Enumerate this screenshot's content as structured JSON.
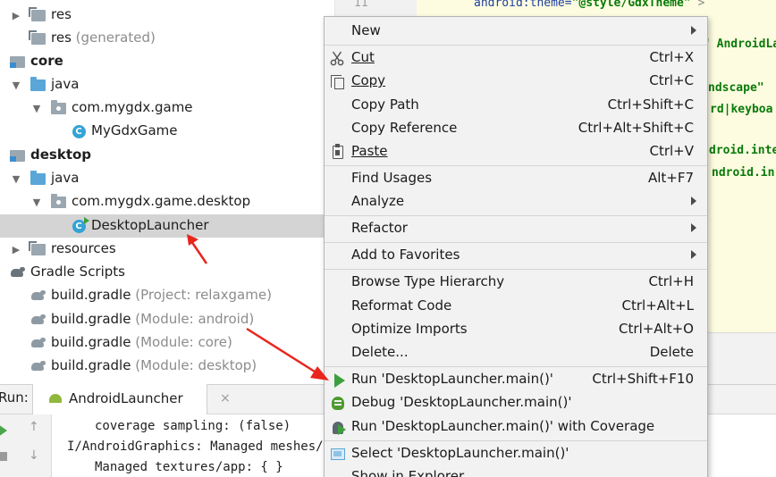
{
  "tree": {
    "rows": [
      {
        "label": "res",
        "extra": ""
      },
      {
        "label": "res",
        "extra": "(generated)"
      },
      {
        "label": "core",
        "extra": ""
      },
      {
        "label": "java",
        "extra": ""
      },
      {
        "label": "com.mygdx.game",
        "extra": ""
      },
      {
        "label": "MyGdxGame",
        "extra": ""
      },
      {
        "label": "desktop",
        "extra": ""
      },
      {
        "label": "java",
        "extra": ""
      },
      {
        "label": "com.mygdx.game.desktop",
        "extra": ""
      },
      {
        "label": "DesktopLauncher",
        "extra": ""
      },
      {
        "label": "resources",
        "extra": ""
      },
      {
        "label": "Gradle Scripts",
        "extra": ""
      },
      {
        "label": "build.gradle",
        "extra": "(Project: relaxgame)"
      },
      {
        "label": "build.gradle",
        "extra": "(Module: android)"
      },
      {
        "label": "build.gradle",
        "extra": "(Module: core)"
      },
      {
        "label": "build.gradle",
        "extra": "(Module: desktop)"
      }
    ]
  },
  "editor": {
    "line_number": "11",
    "lines": [
      {
        "attr": "android:theme=",
        "str": "\"@style/GdxTheme\"",
        "tail": " >"
      },
      {
        "attr": "",
        "str": "\" AndroidLa",
        "tail": ""
      },
      {
        "attr": "",
        "str": "ndscape\"",
        "tail": ""
      },
      {
        "attr": "",
        "str": "rd|keyboa",
        "tail": ""
      },
      {
        "attr": "",
        "str": "droid.inte",
        "tail": ""
      },
      {
        "attr": "",
        "str": "ndroid.in",
        "tail": ""
      }
    ]
  },
  "run_panel": {
    "title": "Run:",
    "tab_label": "AndroidLauncher",
    "tab_close": "×",
    "console_lines": [
      "    coverage sampling: (false)",
      "I/AndroidGraphics: Managed meshes/ap",
      "    Managed textures/app: { }"
    ]
  },
  "menu": {
    "items": [
      {
        "key": "new",
        "label": "New",
        "shortcut": "",
        "submenu": true
      },
      {
        "key": "cut",
        "label": "Cut",
        "shortcut": "Ctrl+X",
        "submenu": false
      },
      {
        "key": "copy",
        "label": "Copy",
        "shortcut": "Ctrl+C",
        "submenu": false
      },
      {
        "key": "copy-path",
        "label": "Copy Path",
        "shortcut": "Ctrl+Shift+C",
        "submenu": false
      },
      {
        "key": "copy-reference",
        "label": "Copy Reference",
        "shortcut": "Ctrl+Alt+Shift+C",
        "submenu": false
      },
      {
        "key": "paste",
        "label": "Paste",
        "shortcut": "Ctrl+V",
        "submenu": false
      },
      {
        "key": "find-usages",
        "label": "Find Usages",
        "shortcut": "Alt+F7",
        "submenu": false
      },
      {
        "key": "analyze",
        "label": "Analyze",
        "shortcut": "",
        "submenu": true
      },
      {
        "key": "refactor",
        "label": "Refactor",
        "shortcut": "",
        "submenu": true
      },
      {
        "key": "add-to-favorites",
        "label": "Add to Favorites",
        "shortcut": "",
        "submenu": true
      },
      {
        "key": "browse-type-hierarchy",
        "label": "Browse Type Hierarchy",
        "shortcut": "Ctrl+H",
        "submenu": false
      },
      {
        "key": "reformat-code",
        "label": "Reformat Code",
        "shortcut": "Ctrl+Alt+L",
        "submenu": false
      },
      {
        "key": "optimize-imports",
        "label": "Optimize Imports",
        "shortcut": "Ctrl+Alt+O",
        "submenu": false
      },
      {
        "key": "delete",
        "label": "Delete...",
        "shortcut": "Delete",
        "submenu": false
      },
      {
        "key": "run",
        "label": "Run 'DesktopLauncher.main()'",
        "shortcut": "Ctrl+Shift+F10",
        "submenu": false
      },
      {
        "key": "debug",
        "label": "Debug 'DesktopLauncher.main()'",
        "shortcut": "",
        "submenu": false
      },
      {
        "key": "run-coverage",
        "label": "Run 'DesktopLauncher.main()' with Coverage",
        "shortcut": "",
        "submenu": false
      },
      {
        "key": "select",
        "label": "Select 'DesktopLauncher.main()'",
        "shortcut": "",
        "submenu": false
      },
      {
        "key": "show-in-explorer",
        "label": "Show in Explorer",
        "shortcut": "",
        "submenu": false
      }
    ]
  },
  "colors": {
    "selection": "#d4d4d4",
    "menu_background": "#f2f2f2",
    "editor_background": "#fdfce0",
    "annotation_red": "#e8261d",
    "run_green": "#3e9f3e"
  }
}
